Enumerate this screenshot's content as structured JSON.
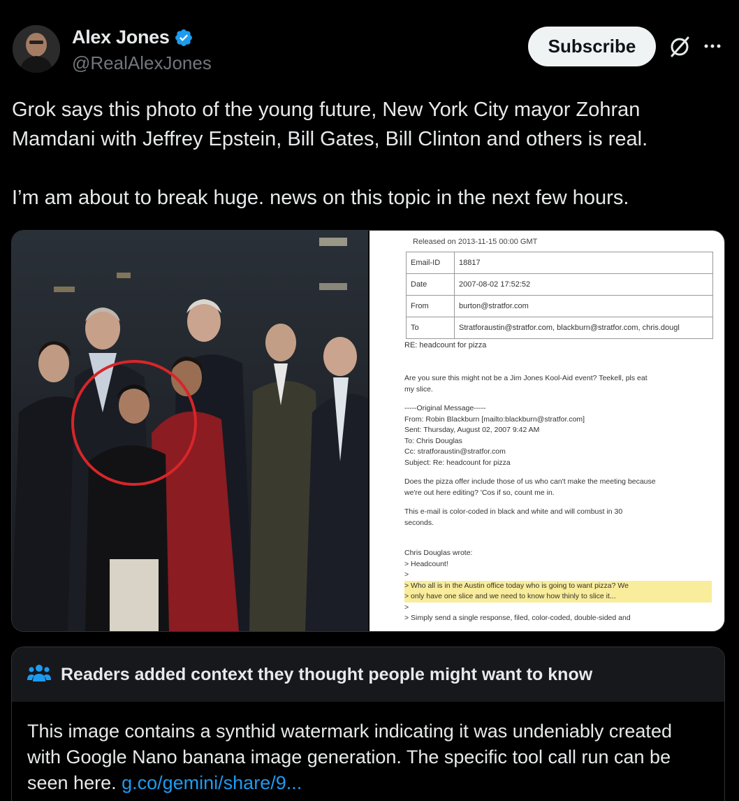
{
  "author": {
    "display_name": "Alex Jones",
    "handle": "@RealAlexJones",
    "verified": true
  },
  "actions": {
    "subscribe_label": "Subscribe",
    "grok_icon": "grok-icon",
    "more_icon": "more-icon"
  },
  "tweet": {
    "paragraph_1": "Grok says this photo of the young future, New York City mayor Zohran Mamdani with Jeffrey Epstein, Bill Gates, Bill Clinton and others is real.",
    "paragraph_2": "I’m am about to break huge. news on this topic in the next few hours."
  },
  "media": {
    "left_photo": "group-photo",
    "doc": {
      "released": "Released on 2013-11-15 00:00 GMT",
      "table": [
        {
          "key": "Email-ID",
          "value": "18817"
        },
        {
          "key": "Date",
          "value": "2007-08-02 17:52:52"
        },
        {
          "key": "From",
          "value": "burton@stratfor.com"
        },
        {
          "key": "To",
          "value": "Stratforaustin@stratfor.com, blackburn@stratfor.com, chris.dougl"
        }
      ],
      "subject_line": "RE: headcount for pizza",
      "reply": "Are you sure this might not be a Jim Jones Kool-Aid event? Teekell, pls eat\nmy slice.",
      "original": "-----Original Message-----\nFrom: Robin Blackburn [mailto:blackburn@stratfor.com]\nSent: Thursday, August 02, 2007 9:42 AM\nTo: Chris Douglas\nCc: stratforaustin@stratfor.com\nSubject: Re: headcount for pizza",
      "pizza_offer": "Does the pizza offer include those of us who can't make the meeting because\nwe're out here editing? 'Cos if so, count me in.",
      "color_coded": "This e-mail is color-coded in black and white and will combust in 30\nseconds.",
      "quoted_intro": "Chris Douglas wrote:\n> Headcount!\n>",
      "quoted_highlight": "> Who all is in the Austin office today who is going to want pizza? We\n> only have one slice and we need to know how thinly to slice it...",
      "quoted_tail": ">\n> Simply send a single response, filed, color-coded, double-sided and"
    }
  },
  "note": {
    "header_icon": "people-icon",
    "title": "Readers added context they thought people might want to know",
    "body": "This image contains a synthid watermark indicating it was undeniably created with Google Nano banana image generation. The specific tool call run can be seen here. ",
    "link_text": "g.co/gemini/share/9..."
  },
  "colors": {
    "background": "#000000",
    "text": "#e7e9ea",
    "muted": "#71767b",
    "link": "#1d9bf0",
    "verified": "#1d9bf0"
  }
}
